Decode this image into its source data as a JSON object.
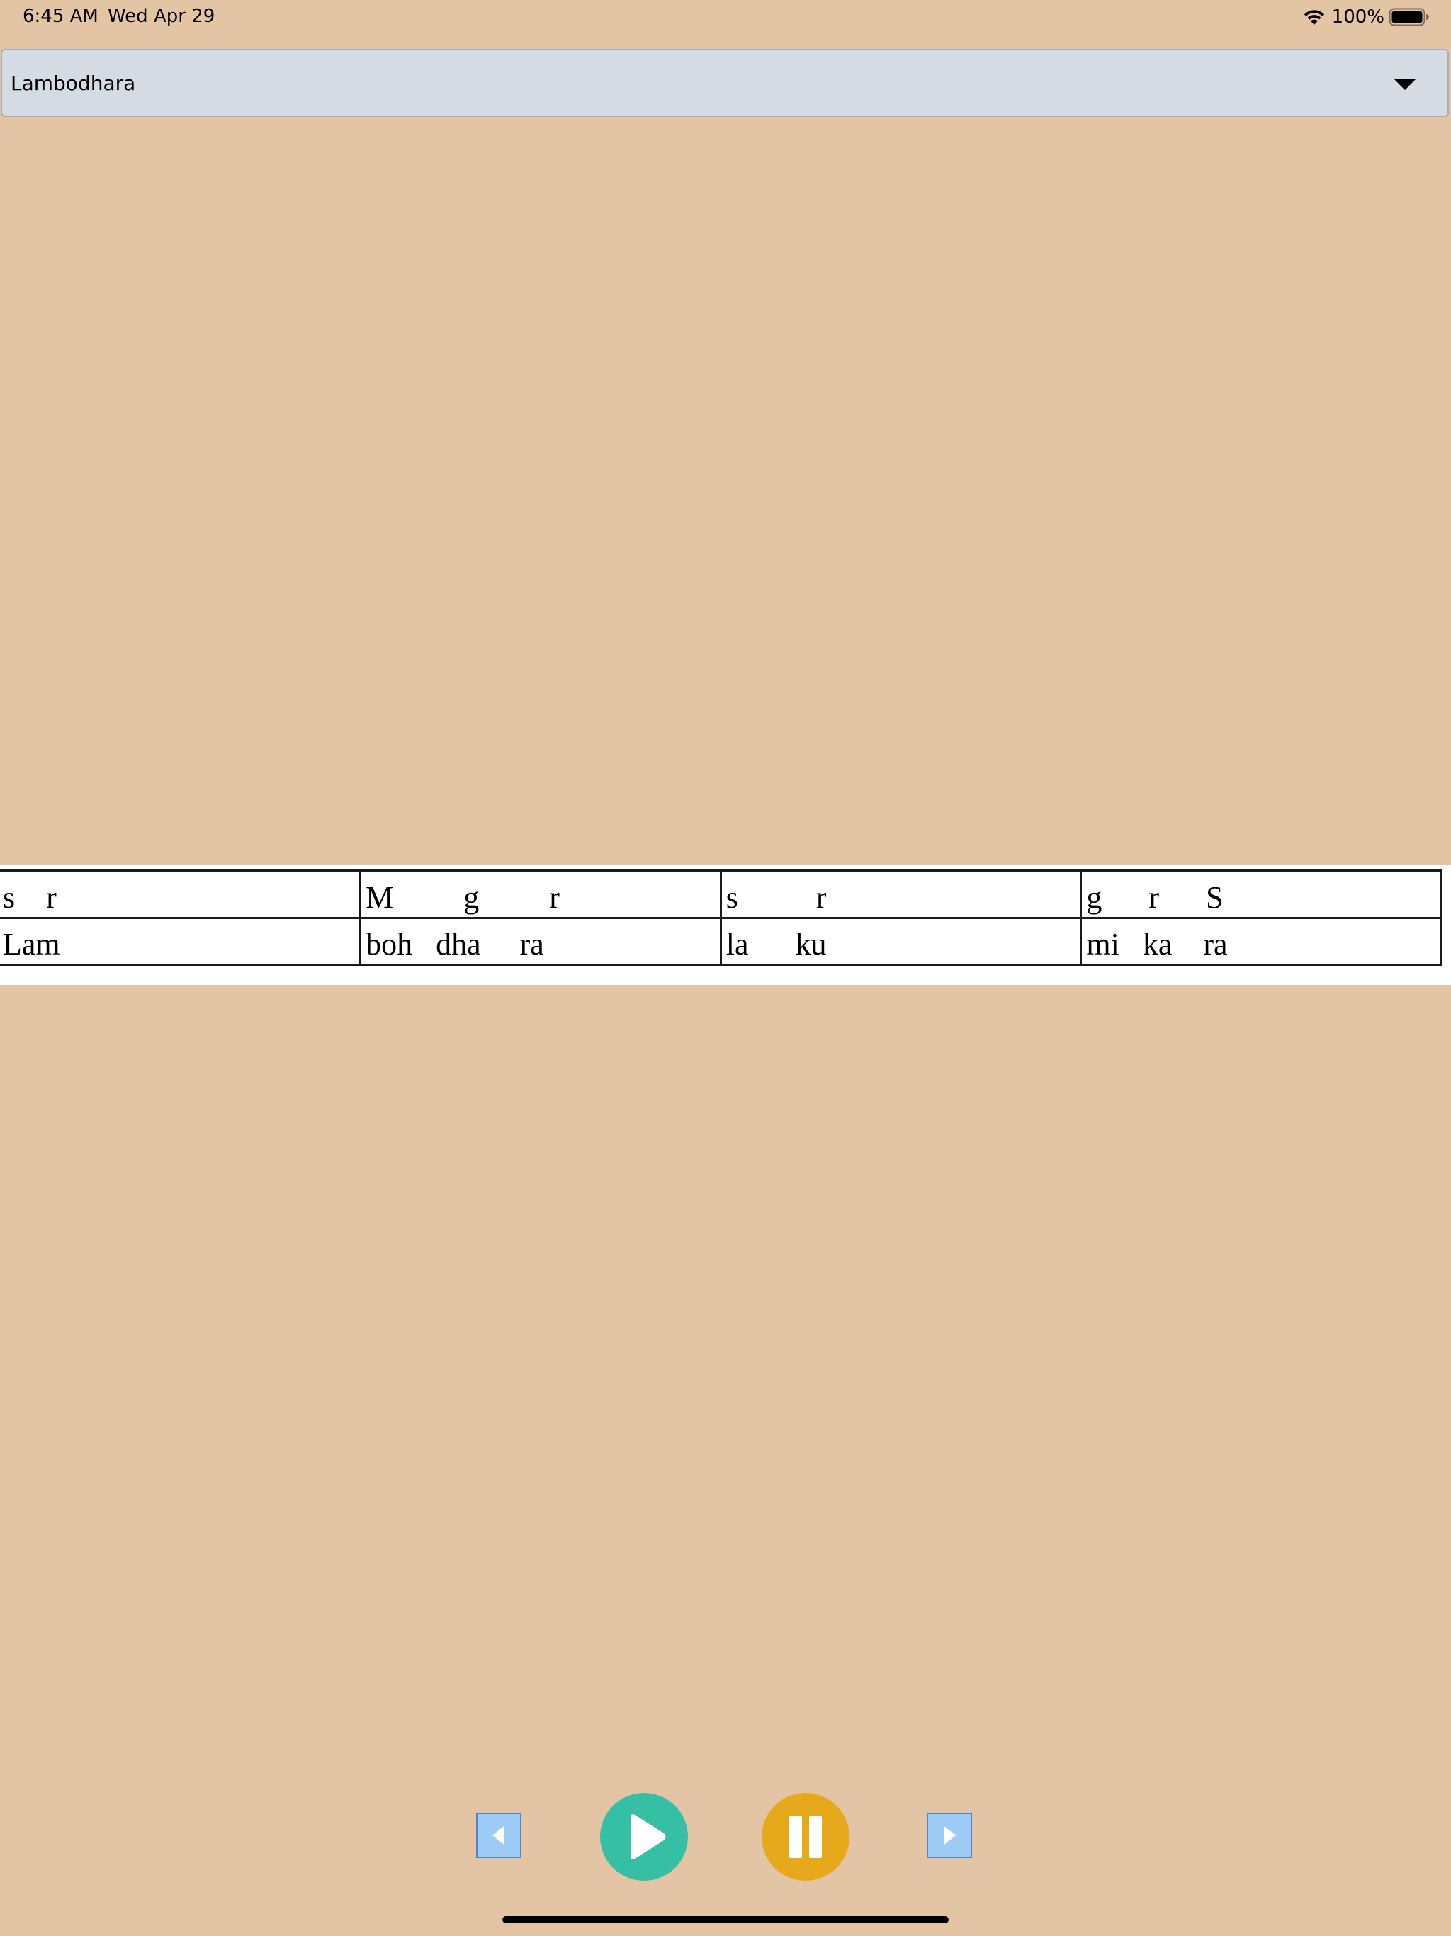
{
  "status_bar": {
    "time": "6:45 AM",
    "date": "Wed Apr 29",
    "battery_percent": "100%",
    "icons": [
      "wifi-icon",
      "battery-icon"
    ]
  },
  "dropdown": {
    "selected": "Lambodhara",
    "caret_icon": "chevron-down-icon"
  },
  "notation": {
    "swara_row": [
      "s    r",
      "M         g         r",
      "s          r",
      "g      r      S"
    ],
    "lyric_row": [
      "Lam",
      "boh   dha     ra",
      "la      ku",
      "mi   ka    ra"
    ]
  },
  "controls": {
    "icons": [
      "previous-icon",
      "play-icon",
      "pause-icon",
      "next-icon"
    ],
    "colors": {
      "play": "#35bfa5",
      "pause": "#e6a91c",
      "nav": "#9ccbf5"
    }
  },
  "colors": {
    "background": "#e3c4a4",
    "dropdown_bg": "#d4dbe2"
  }
}
